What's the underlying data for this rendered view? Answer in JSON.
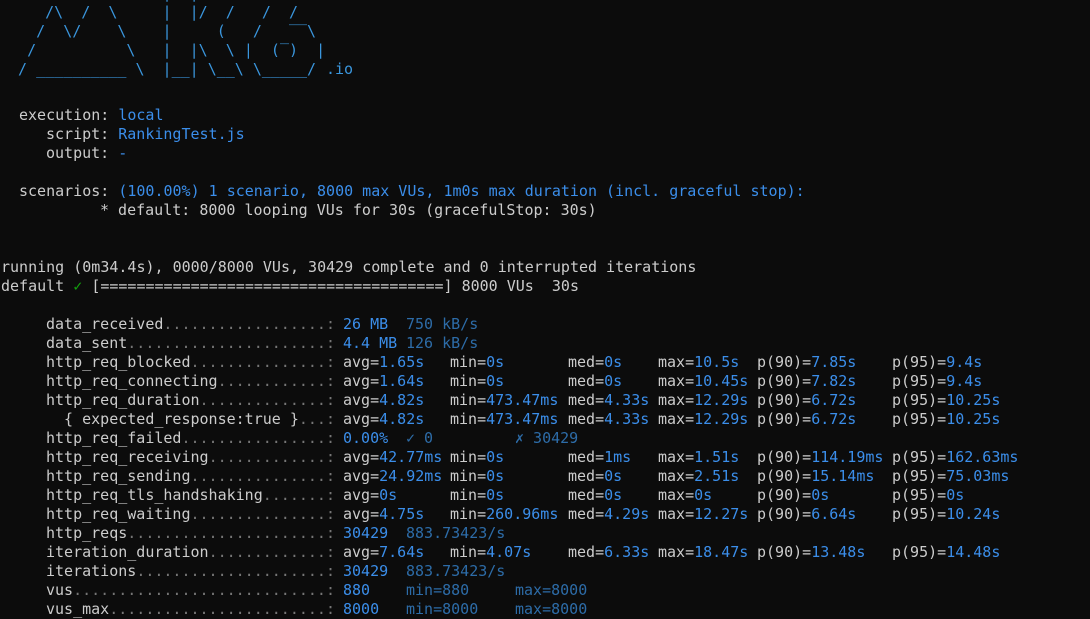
{
  "colors": {
    "background": "#0c0c0c",
    "text": "#cccccc",
    "accent": "#3b8eea",
    "dim_accent": "#2d6ca8",
    "logo": "#3a96dd",
    "check": "#13a10e"
  },
  "logo": {
    "lines": [
      "          /\\      |‾‾| /‾‾/   /‾‾/",
      "     /\\  /  \\     |  |/  /   /  /",
      "    /  \\/    \\    |     (   /   ‾‾\\",
      "   /          \\   |  |\\  \\ |  (‾)  |",
      "  / __________ \\  |__| \\__\\ \\_____/"
    ],
    "suffix": ".io"
  },
  "execution": {
    "execution_label": "execution:",
    "execution_value": "local",
    "script_label": "script:",
    "script_value": "RankingTest.js",
    "output_label": "output:",
    "output_value": "-",
    "scenarios_label": "scenarios:",
    "scenarios_value": "(100.00%) 1 scenario, 8000 max VUs, 1m0s max duration (incl. graceful stop):",
    "scenario_detail": "* default: 8000 looping VUs for 30s (gracefulStop: 30s)"
  },
  "progress": {
    "running_line": "running (0m34.4s), 0000/8000 VUs, 30429 complete and 0 interrupted iterations",
    "name": "default",
    "check": "✓",
    "bar": "[======================================]",
    "vus_text": "8000 VUs  30s"
  },
  "metrics": [
    {
      "name": "data_received",
      "dots": "..................:",
      "type": "rate",
      "value": "26 MB",
      "rate": "750 kB/s"
    },
    {
      "name": "data_sent",
      "dots": "......................:",
      "type": "rate",
      "value": "4.4 MB",
      "rate": "126 kB/s"
    },
    {
      "name": "http_req_blocked",
      "dots": "...............:",
      "type": "trend",
      "avg": "1.65s",
      "min": "0s",
      "med": "0s",
      "max": "10.5s",
      "p90": "7.85s",
      "p95": "9.4s"
    },
    {
      "name": "http_req_connecting",
      "dots": "............:",
      "type": "trend",
      "avg": "1.64s",
      "min": "0s",
      "med": "0s",
      "max": "10.45s",
      "p90": "7.82s",
      "p95": "9.4s"
    },
    {
      "name": "http_req_duration",
      "dots": "..............:",
      "type": "trend",
      "avg": "4.82s",
      "min": "473.47ms",
      "med": "4.33s",
      "max": "12.29s",
      "p90": "6.72s",
      "p95": "10.25s"
    },
    {
      "name": "  { expected_response:true }",
      "dots": "...:",
      "type": "trend",
      "avg": "4.82s",
      "min": "473.47ms",
      "med": "4.33s",
      "max": "12.29s",
      "p90": "6.72s",
      "p95": "10.25s"
    },
    {
      "name": "http_req_failed",
      "dots": "................:",
      "type": "fail",
      "value": "0.00%",
      "pass": "✓ 0",
      "fail": "✗ 30429"
    },
    {
      "name": "http_req_receiving",
      "dots": ".............:",
      "type": "trend",
      "avg": "42.77ms",
      "min": "0s",
      "med": "1ms",
      "max": "1.51s",
      "p90": "114.19ms",
      "p95": "162.63ms"
    },
    {
      "name": "http_req_sending",
      "dots": "...............:",
      "type": "trend",
      "avg": "24.92ms",
      "min": "0s",
      "med": "0s",
      "max": "2.51s",
      "p90": "15.14ms",
      "p95": "75.03ms"
    },
    {
      "name": "http_req_tls_handshaking",
      "dots": ".......:",
      "type": "trend",
      "avg": "0s",
      "min": "0s",
      "med": "0s",
      "max": "0s",
      "p90": "0s",
      "p95": "0s"
    },
    {
      "name": "http_req_waiting",
      "dots": "...............:",
      "type": "trend",
      "avg": "4.75s",
      "min": "260.96ms",
      "med": "4.29s",
      "max": "12.27s",
      "p90": "6.64s",
      "p95": "10.24s"
    },
    {
      "name": "http_reqs",
      "dots": "......................:",
      "type": "rate",
      "value": "30429",
      "rate": "883.73423/s"
    },
    {
      "name": "iteration_duration",
      "dots": ".............:",
      "type": "trend",
      "avg": "7.64s",
      "min": "4.07s",
      "med": "6.33s",
      "max": "18.47s",
      "p90": "13.48s",
      "p95": "14.48s"
    },
    {
      "name": "iterations",
      "dots": ".....................:",
      "type": "rate",
      "value": "30429",
      "rate": "883.73423/s"
    },
    {
      "name": "vus",
      "dots": "............................:",
      "type": "gauge",
      "value": "880",
      "min": "880",
      "max": "8000"
    },
    {
      "name": "vus_max",
      "dots": "........................:",
      "type": "gauge",
      "value": "8000",
      "min": "8000",
      "max": "8000"
    }
  ]
}
